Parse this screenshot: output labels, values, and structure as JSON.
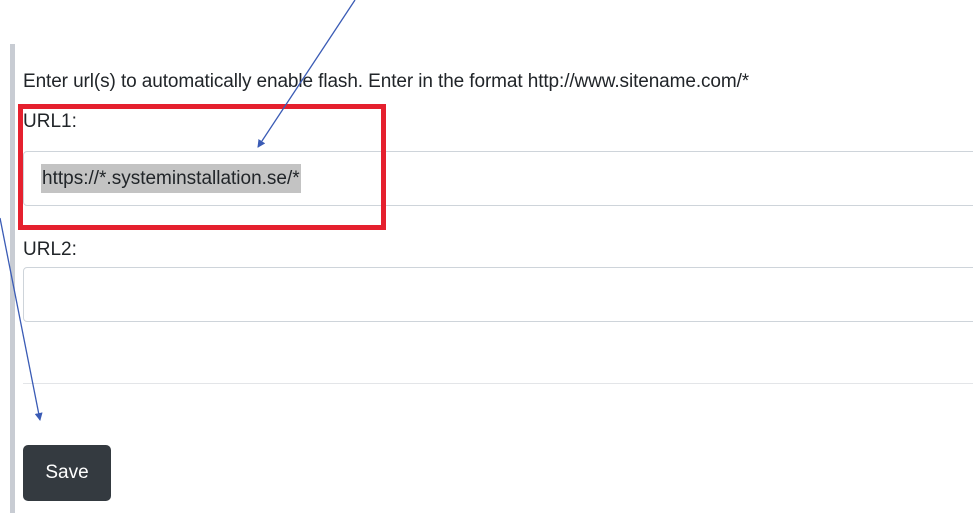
{
  "form": {
    "instructions": "Enter url(s) to automatically enable flash. Enter in the format http://www.sitename.com/*",
    "url1": {
      "label": "URL1:",
      "value": "https://*.systeminstallation.se/*"
    },
    "url2": {
      "label": "URL2:",
      "value": ""
    },
    "save_label": "Save"
  },
  "colors": {
    "highlight_box": "#e5202e",
    "arrow": "#3a5bb5",
    "button_bg": "#343a40",
    "selection": "#c3c3c3"
  },
  "icons": [
    "arrow-annotation-icon"
  ]
}
